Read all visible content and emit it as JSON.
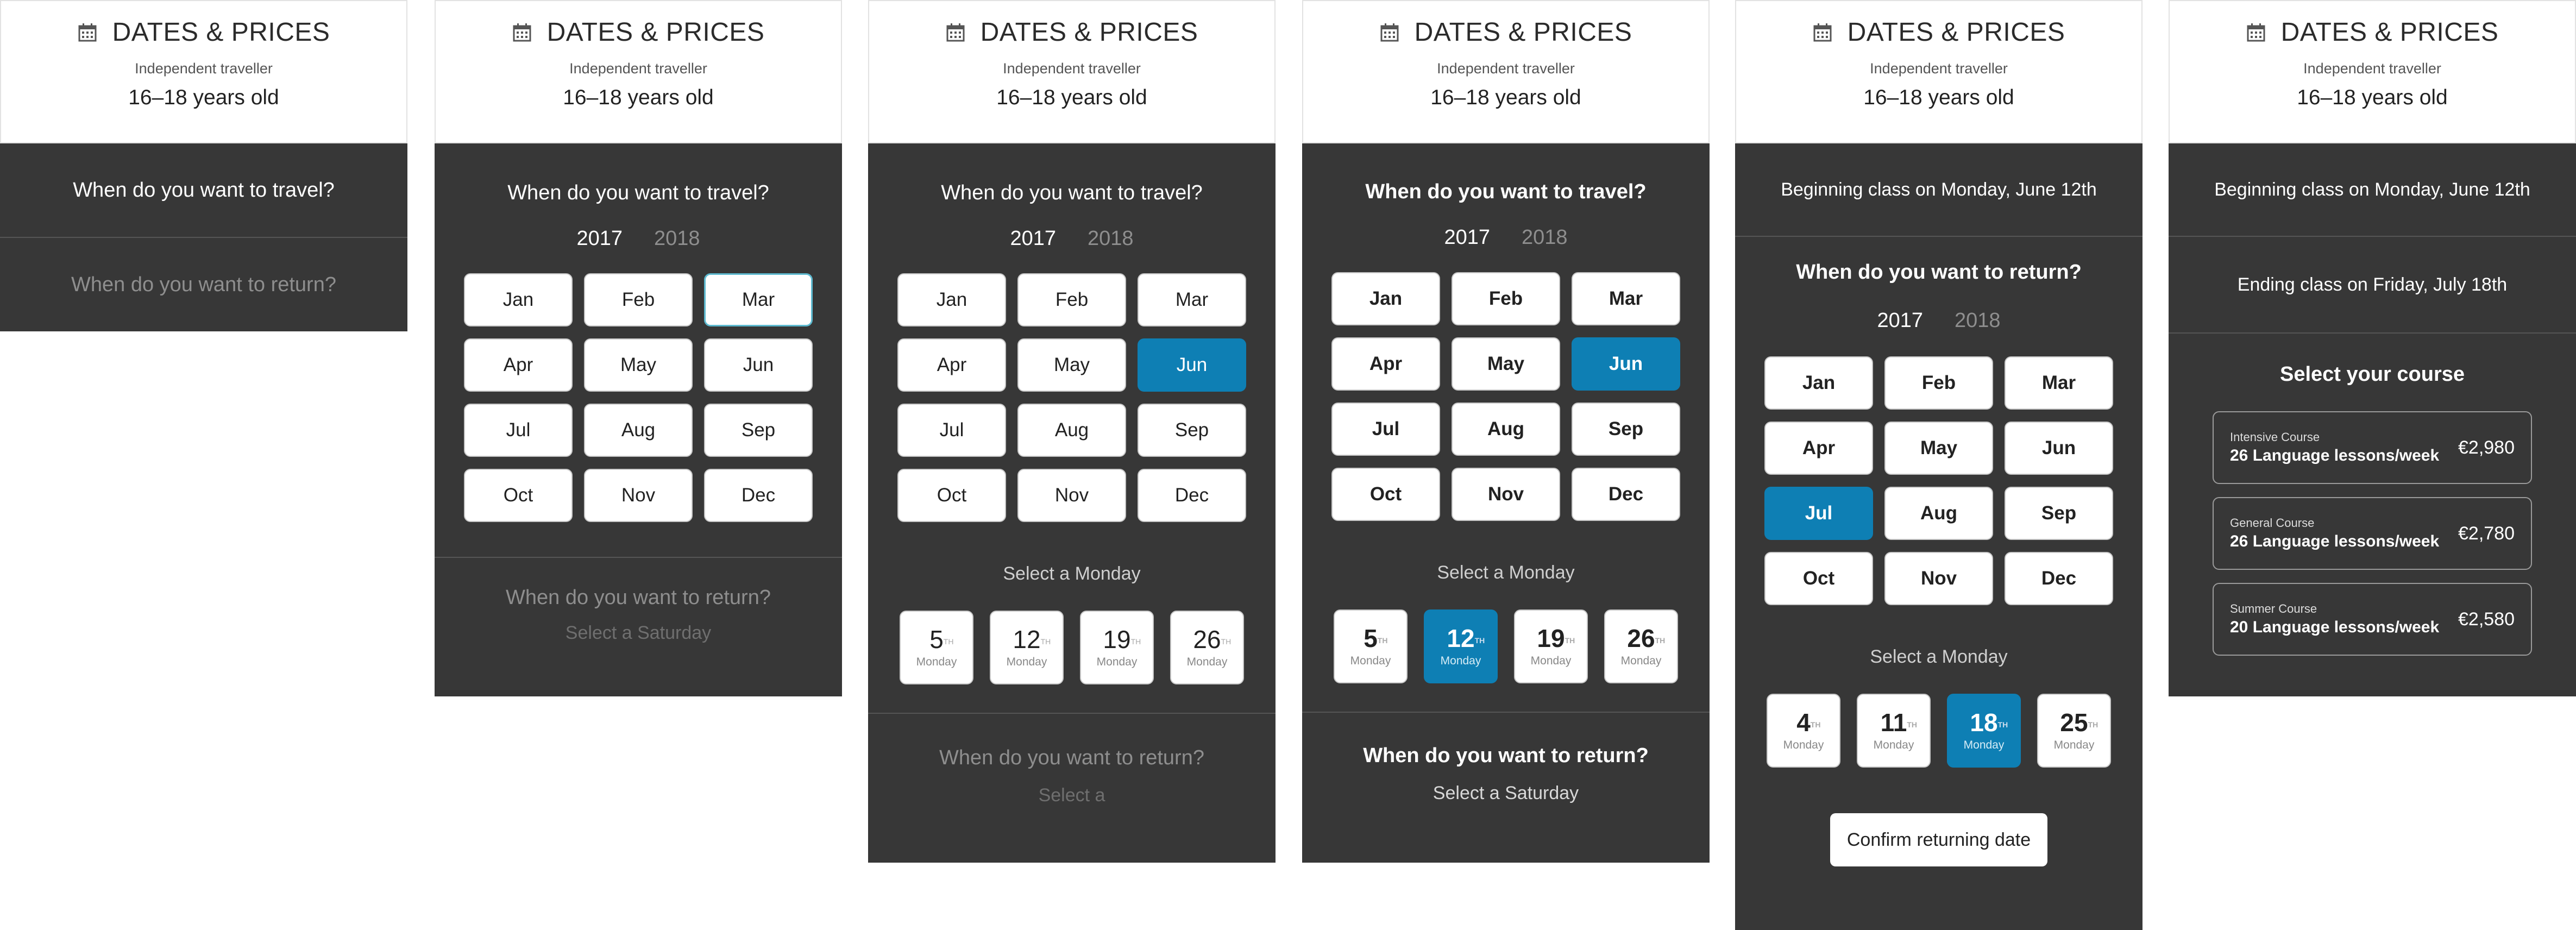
{
  "header": {
    "title": "DATES & PRICES",
    "subtitle": "Independent traveller",
    "age": "16–18 years old",
    "icon": "calendar-icon"
  },
  "travel_question": "When do you want to travel?",
  "return_question": "When do you want to return?",
  "years": [
    "2017",
    "2018"
  ],
  "months": [
    "Jan",
    "Feb",
    "Mar",
    "Apr",
    "May",
    "Jun",
    "Jul",
    "Aug",
    "Sep",
    "Oct",
    "Nov",
    "Dec"
  ],
  "select_monday": "Select a Monday",
  "select_saturday": "Select a Saturday",
  "select_partial": "Select a",
  "mondays_june": [
    {
      "num": "5",
      "sup": "TH",
      "day": "Monday"
    },
    {
      "num": "12",
      "sup": "TH",
      "day": "Monday"
    },
    {
      "num": "19",
      "sup": "TH",
      "day": "Monday"
    },
    {
      "num": "26",
      "sup": "TH",
      "day": "Monday"
    }
  ],
  "mondays_july": [
    {
      "num": "4",
      "sup": "TH",
      "day": "Monday"
    },
    {
      "num": "11",
      "sup": "TH",
      "day": "Monday"
    },
    {
      "num": "18",
      "sup": "TH",
      "day": "Monday"
    },
    {
      "num": "25",
      "sup": "TH",
      "day": "Monday"
    }
  ],
  "beginning_class": "Beginning class on Monday, June 12th",
  "ending_class": "Ending class on Friday, July 18th",
  "confirm_label": "Confirm returning date",
  "select_course": "Select your course",
  "courses": [
    {
      "name": "Intensive Course",
      "lessons": "26 Language lessons/week",
      "price": "€2,980"
    },
    {
      "name": "General Course",
      "lessons": "26 Language lessons/week",
      "price": "€2,780"
    },
    {
      "name": "Summer Course",
      "lessons": "20 Language lessons/week",
      "price": "€2,580"
    }
  ],
  "colors": {
    "accent": "#0e7fb4",
    "dark": "#373737",
    "highlight": "#5db9cf"
  }
}
